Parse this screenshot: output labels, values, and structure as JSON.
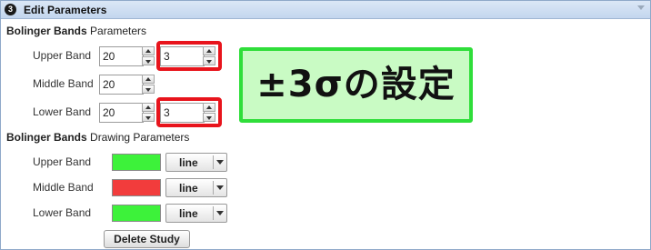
{
  "dialog": {
    "title": "Edit Parameters",
    "step_number": "3"
  },
  "parameters": {
    "section_bold": "Bolinger Bands",
    "section_rest": " Parameters",
    "upper": {
      "label": "Upper Band",
      "value1": "20",
      "value2": "3"
    },
    "middle": {
      "label": "Middle Band",
      "value1": "20"
    },
    "lower": {
      "label": "Lower Band",
      "value1": "20",
      "value2": "3"
    }
  },
  "drawing": {
    "section_bold": "Bolinger Bands",
    "section_rest": " Drawing Parameters",
    "upper": {
      "label": "Upper Band",
      "color": "#3df23a",
      "style": "line"
    },
    "middle": {
      "label": "Middle Band",
      "color": "#f23c3c",
      "style": "line"
    },
    "lower": {
      "label": "Lower Band",
      "color": "#3df23a",
      "style": "line"
    }
  },
  "delete_button": "Delete Study",
  "annotation": {
    "text": "±3σの設定",
    "border_color": "#2fde3a",
    "background_color": "#c9fbc4",
    "highlight_color": "#e8141c"
  }
}
